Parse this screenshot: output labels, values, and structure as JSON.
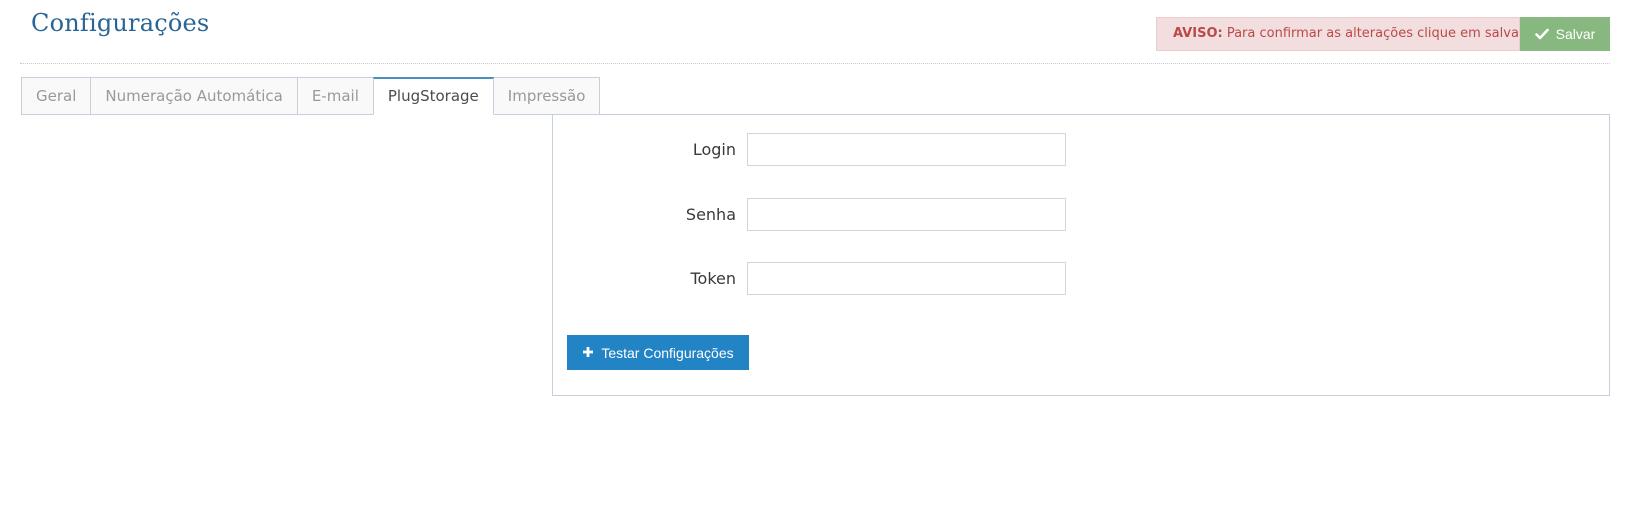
{
  "page": {
    "title": "Configurações"
  },
  "notice": {
    "label": "AVISO:",
    "text": " Para confirmar as alterações clique em salvar!"
  },
  "actions": {
    "save_label": "Salvar",
    "test_label": "Testar Configurações"
  },
  "tabs": [
    {
      "label": "Geral",
      "active": false
    },
    {
      "label": "Numeração Automática",
      "active": false
    },
    {
      "label": "E-mail",
      "active": false
    },
    {
      "label": "PlugStorage",
      "active": true
    },
    {
      "label": "Impressão",
      "active": false
    }
  ],
  "form": {
    "login": {
      "label": "Login",
      "value": ""
    },
    "senha": {
      "label": "Senha",
      "value": ""
    },
    "token": {
      "label": "Token",
      "value": ""
    }
  },
  "colors": {
    "title": "#2a6496",
    "notice_bg": "#f2dede",
    "notice_text": "#b94a48",
    "save_bg": "#87b87f",
    "primary_bg": "#2283c5",
    "tab_active_top": "#4c8fbd"
  },
  "icons": {
    "save": "check-icon",
    "test": "plus-icon"
  }
}
